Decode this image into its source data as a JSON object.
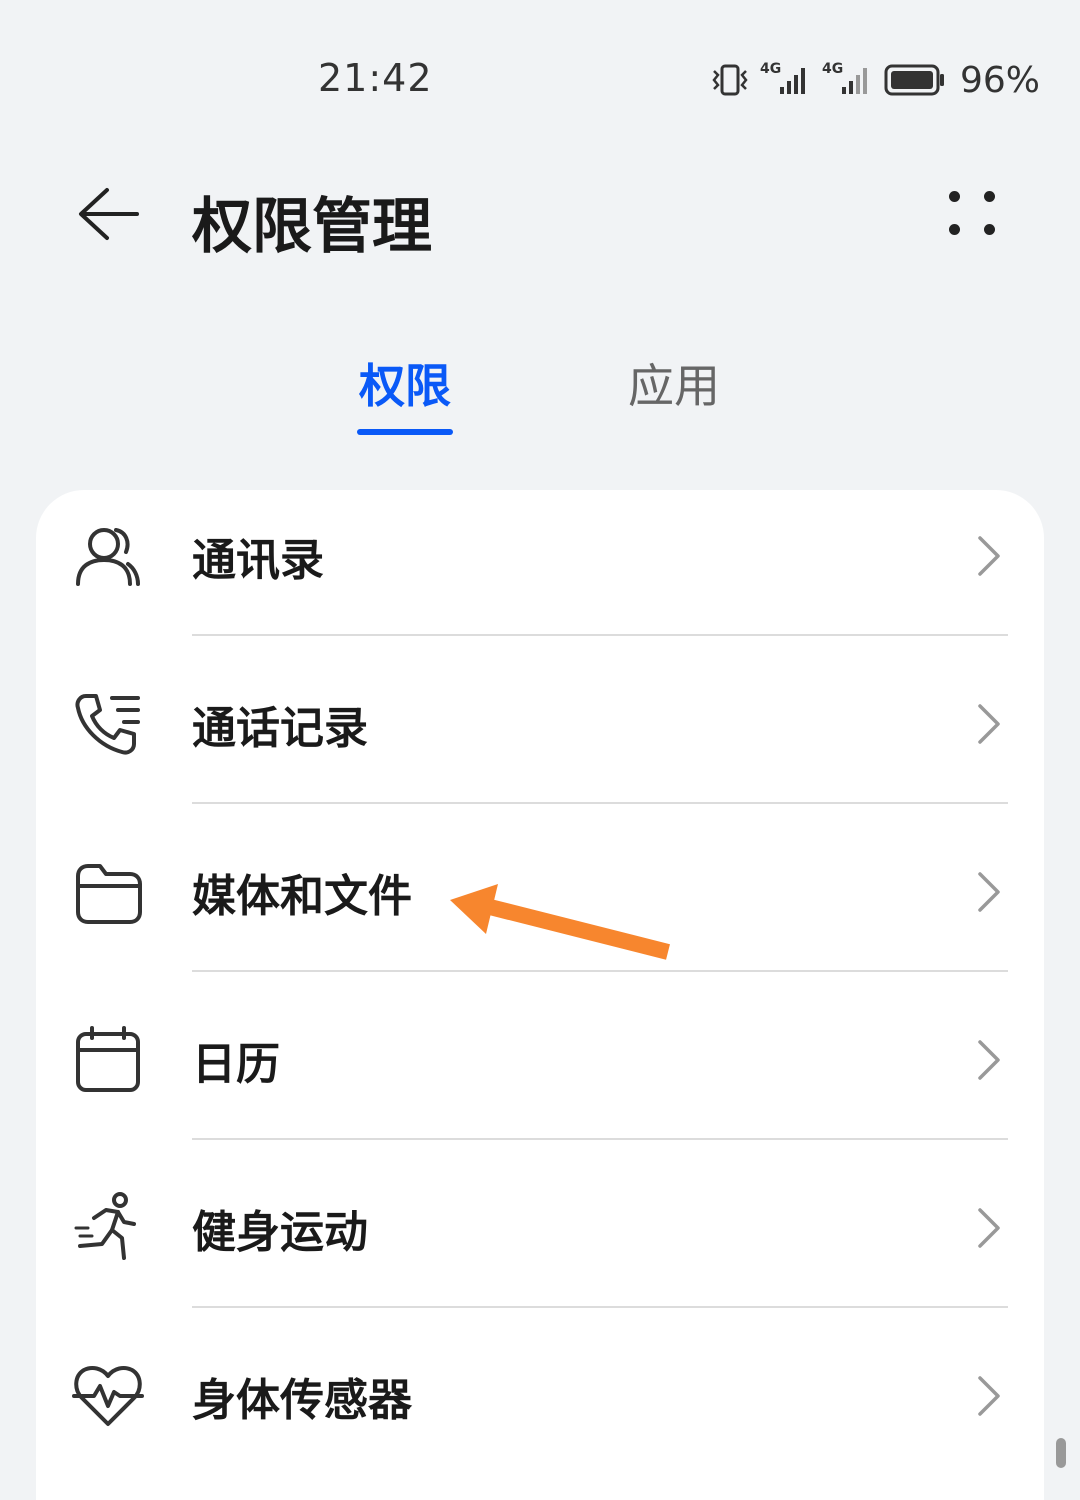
{
  "status_bar": {
    "time": "21:42",
    "battery": "96%",
    "signal_label_1": "4G",
    "signal_label_2": "4G",
    "icons": [
      "vibrate-icon",
      "signal-4g-icon",
      "signal-4g-icon",
      "battery-icon"
    ]
  },
  "header": {
    "title": "权限管理",
    "back_icon": "back-arrow-icon",
    "more_icon": "more-dots-icon"
  },
  "tabs": [
    {
      "label": "权限",
      "active": true
    },
    {
      "label": "应用",
      "active": false
    }
  ],
  "permissions": [
    {
      "label": "通讯录",
      "icon": "contacts-icon"
    },
    {
      "label": "通话记录",
      "icon": "call-log-icon"
    },
    {
      "label": "媒体和文件",
      "icon": "folder-icon"
    },
    {
      "label": "日历",
      "icon": "calendar-icon"
    },
    {
      "label": "健身运动",
      "icon": "running-icon"
    },
    {
      "label": "身体传感器",
      "icon": "heart-rate-icon"
    }
  ],
  "colors": {
    "accent": "#0A59F7",
    "background": "#F1F3F5",
    "card": "#FFFFFF",
    "annotation": "#F7862E"
  }
}
